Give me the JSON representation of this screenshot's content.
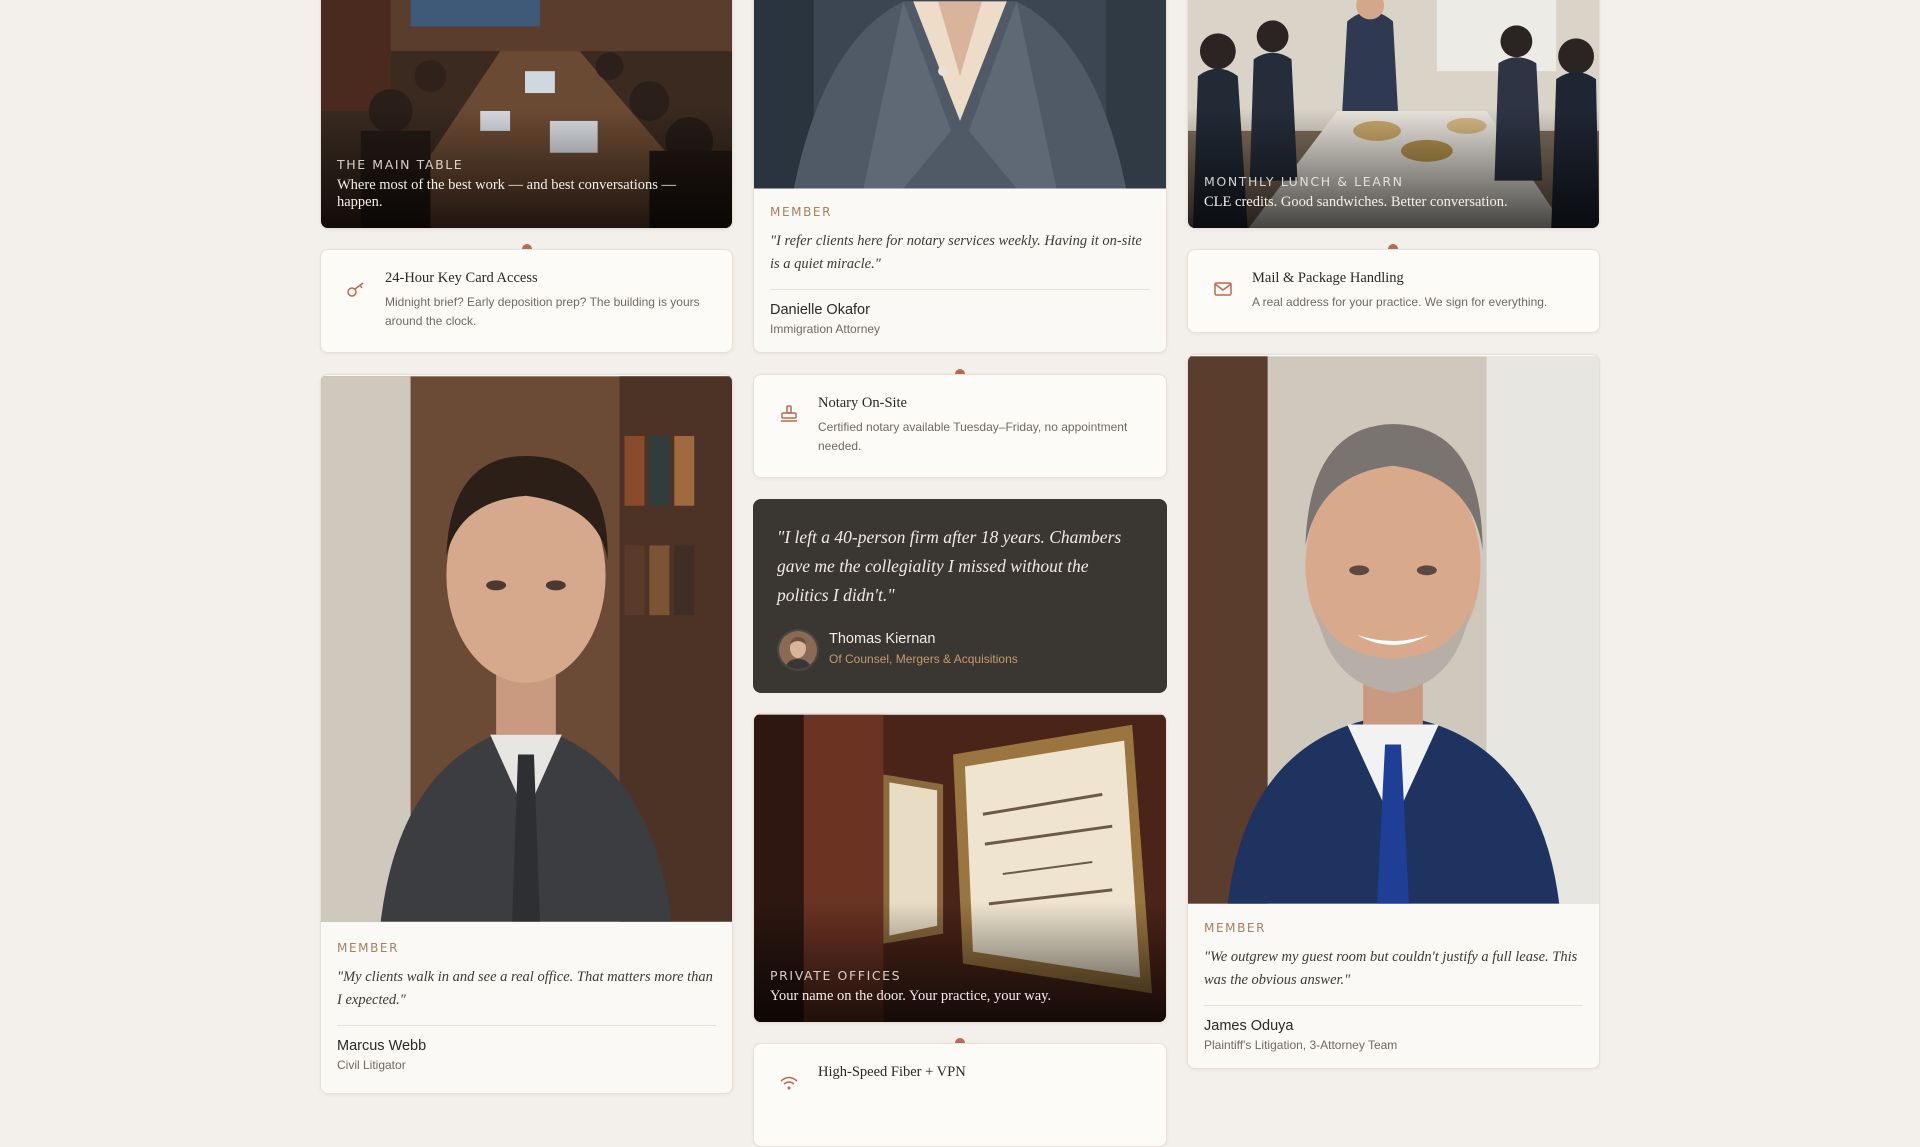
{
  "colors": {
    "background": "#f3efeb",
    "accent": "#b96b4f",
    "eyebrow": "#a8805e",
    "dark_card": "#3a3733",
    "dark_card_role": "#c49a6c"
  },
  "photo_tiles": [
    {
      "eyebrow": "THE MAIN TABLE",
      "caption": "Where most of the best work — and best conversations — happen."
    },
    {
      "eyebrow": "MONTHLY LUNCH & LEARN",
      "caption": "CLE credits. Good sandwiches. Better conversation."
    },
    {
      "eyebrow": "PRIVATE OFFICES",
      "caption": "Your name on the door. Your practice, your way."
    }
  ],
  "member_cards": [
    {
      "eyebrow": "MEMBER",
      "quote": "\"I refer clients here for notary services weekly. Having it on-site is a quiet miracle.\"",
      "name": "Danielle Okafor",
      "role": "Immigration Attorney"
    },
    {
      "eyebrow": "MEMBER",
      "quote": "\"My clients walk in and see a real office. That matters more than I expected.\"",
      "name": "Marcus Webb",
      "role": "Civil Litigator"
    },
    {
      "eyebrow": "MEMBER",
      "quote": "\"We outgrew my guest room but couldn't justify a full lease. This was the obvious answer.\"",
      "name": "James Oduya",
      "role": "Plaintiff's Litigation, 3-Attorney Team"
    }
  ],
  "features": [
    {
      "icon": "key-icon",
      "title": "24-Hour Key Card Access",
      "description": "Midnight brief? Early deposition prep? The building is yours around the clock."
    },
    {
      "icon": "mail-icon",
      "title": "Mail & Package Handling",
      "description": "A real address for your practice. We sign for everything."
    },
    {
      "icon": "stamp-icon",
      "title": "Notary On-Site",
      "description": "Certified notary available Tuesday–Friday, no appointment needed."
    },
    {
      "icon": "wifi-icon",
      "title": "High-Speed Fiber + VPN",
      "description": ""
    }
  ],
  "testimonial": {
    "quote": "\"I left a 40-person firm after 18 years. Chambers gave me the collegiality I missed without the politics I didn't.\"",
    "name": "Thomas Kiernan",
    "role": "Of Counsel, Mergers & Acquisitions"
  }
}
